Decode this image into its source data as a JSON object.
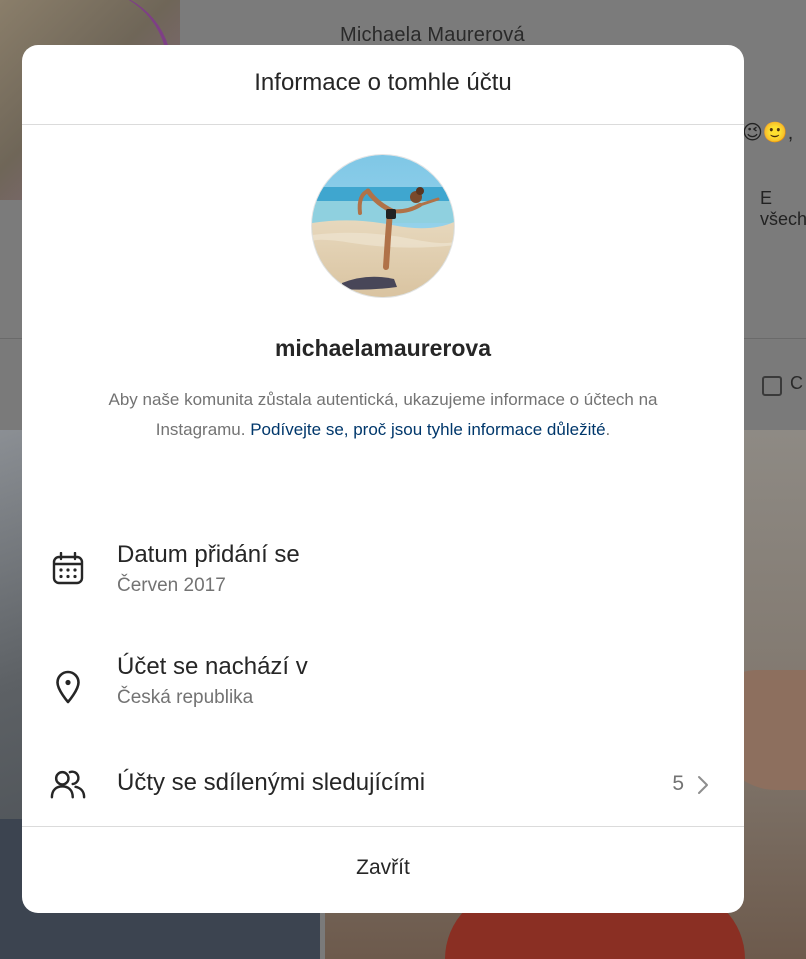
{
  "background": {
    "profile_name": "Michaela Maurerová",
    "bio_fragment": "E všech",
    "tab_fragment": "C"
  },
  "modal": {
    "title": "Informace o tomhle účtu",
    "username": "michaelamaurerova",
    "info_text": "Aby naše komunita zůstala autentická, ukazujeme informace o účtech na Instagramu. ",
    "info_link": "Podívejte se, proč jsou tyhle informace důležité",
    "info_end": ".",
    "rows": {
      "date_joined": {
        "title": "Datum přidání se",
        "value": "Červen 2017",
        "icon": "calendar-icon"
      },
      "location": {
        "title": "Účet se nachází v",
        "value": "Česká republika",
        "icon": "location-pin-icon"
      },
      "shared_followers": {
        "title": "Účty se sdílenými sledujícími",
        "count": "5",
        "icon": "people-icon"
      }
    },
    "close_label": "Zavřít"
  },
  "colors": {
    "text_primary": "#262626",
    "text_secondary": "#737373",
    "link": "#00376b",
    "divider": "#dbdbdb",
    "overlay": "#7a7a7a"
  }
}
